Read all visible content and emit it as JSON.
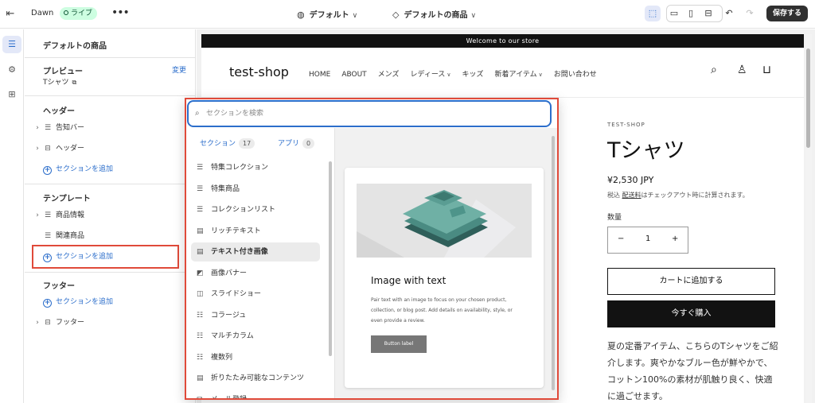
{
  "topbar": {
    "store_name": "Dawn",
    "status_badge": "ライブ",
    "theme_selector": "デフォルト",
    "template_selector": "デフォルトの商品",
    "save_label": "保存する"
  },
  "sidebar": {
    "title": "デフォルトの商品",
    "preview_label": "プレビュー",
    "preview_change": "変更",
    "preview_value": "Tシャツ",
    "header_group": "ヘッダー",
    "header_items": [
      "告知バー",
      "ヘッダー"
    ],
    "template_group": "テンプレート",
    "template_items": [
      "商品情報",
      "関連商品"
    ],
    "footer_group": "フッター",
    "footer_items": [
      "フッター"
    ],
    "add_section": "セクションを追加"
  },
  "store": {
    "announcement": "Welcome to our store",
    "logo": "test-shop",
    "nav": [
      "HOME",
      "ABOUT",
      "メンズ",
      "レディース",
      "キッズ",
      "新着アイテム",
      "お問い合わせ"
    ],
    "product": {
      "vendor": "TEST-SHOP",
      "title": "Tシャツ",
      "price": "¥2,530 JPY",
      "tax_prefix": "税込 ",
      "tax_link": "配送料",
      "tax_suffix": "はチェックアウト時に計算されます。",
      "qty_label": "数量",
      "qty_minus": "−",
      "qty_value": "1",
      "qty_plus": "+",
      "add_to_cart": "カートに追加する",
      "buy_now": "今すぐ購入",
      "description": "夏の定番アイテム、こちらのTシャツをご紹介します。爽やかなブルー色が鮮やかで、コットン100%の素材が肌触り良く、快適に過ごせます。"
    }
  },
  "picker": {
    "search_placeholder": "セクションを検索",
    "tab_sections": "セクション",
    "tab_sections_count": "17",
    "tab_apps": "アプリ",
    "tab_apps_count": "0",
    "items": [
      "特集コレクション",
      "特集商品",
      "コレクションリスト",
      "リッチテキスト",
      "テキスト付き画像",
      "画像バナー",
      "スライドショー",
      "コラージュ",
      "マルチカラム",
      "複数列",
      "折りたたみ可能なコンテンツ",
      "メール登録"
    ],
    "selected_index": 4,
    "preview_title": "Image with text",
    "preview_desc": "Pair text with an image to focus on your chosen product, collection, or blog post. Add details on availability, style, or even provide a review.",
    "preview_button": "Button label"
  },
  "colors": {
    "accent": "#2c6ecb",
    "highlight": "#e04a3a",
    "live_badge": "#cdfee1"
  }
}
